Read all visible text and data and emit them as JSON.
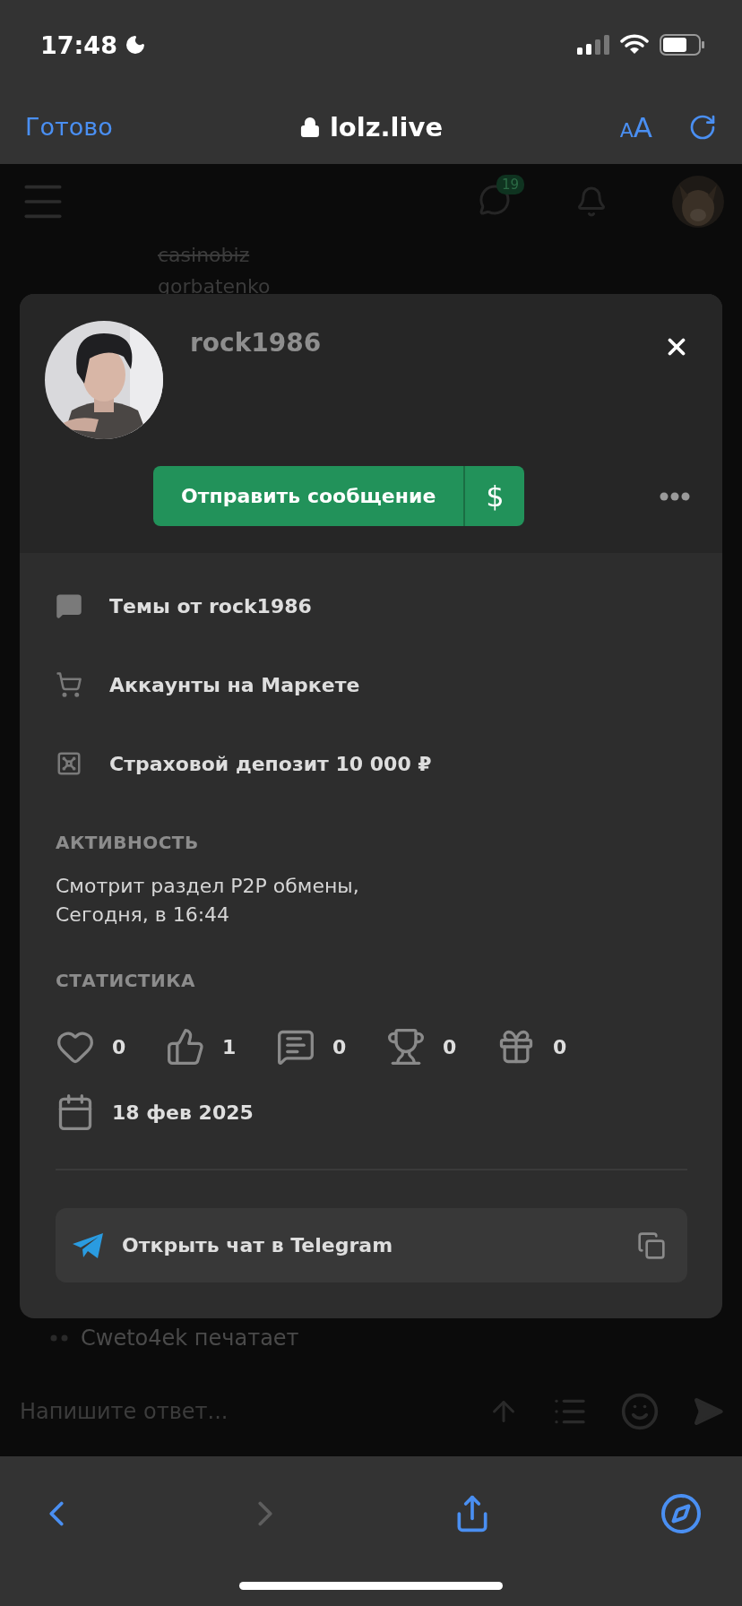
{
  "status_bar": {
    "time": "17:48"
  },
  "browser_bar": {
    "done": "Готово",
    "url": "lolz.live",
    "text_size": "AA"
  },
  "page": {
    "notification_count": "19",
    "threads": [
      {
        "title": "casinobiz",
        "struck": true
      },
      {
        "title": "gorbatenko",
        "struck": false
      }
    ],
    "typing": "Cweto4ek печатает",
    "reply_placeholder": "Напишите ответ..."
  },
  "profile_popup": {
    "username": "rock1986",
    "message_button": "Отправить сообщение",
    "money_button": "$",
    "links": [
      {
        "kind": "topics",
        "label": "Темы от rock1986"
      },
      {
        "kind": "market",
        "label": "Аккаунты на Маркете"
      },
      {
        "kind": "deposit",
        "label": "Страховой депозит 10 000 ₽"
      }
    ],
    "activity": {
      "heading": "АКТИВНОСТЬ",
      "lines": [
        "Смотрит раздел P2P обмены,",
        "Сегодня, в 16:44"
      ]
    },
    "stats": {
      "heading": "СТАТИСТИКА",
      "counters": [
        {
          "kind": "likes",
          "value": "0"
        },
        {
          "kind": "thumbs",
          "value": "1"
        },
        {
          "kind": "messages",
          "value": "0"
        },
        {
          "kind": "trophies",
          "value": "0"
        },
        {
          "kind": "gifts",
          "value": "0"
        }
      ],
      "registered": "18 фев 2025"
    },
    "telegram_button": "Открыть чат в Telegram"
  }
}
